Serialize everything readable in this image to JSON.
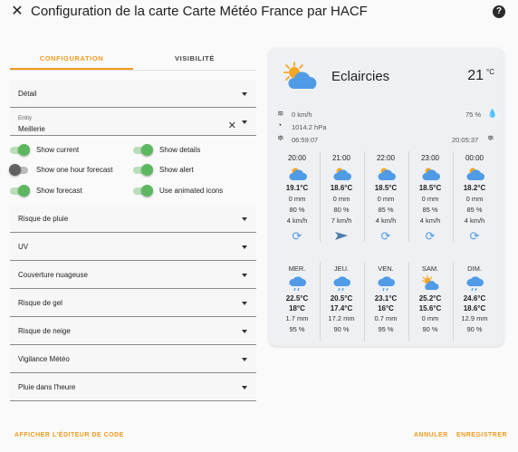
{
  "dialog": {
    "title": "Configuration de la carte Carte Météo France par HACF",
    "close_icon": "close-icon",
    "help_icon": "help-icon"
  },
  "tabs": [
    {
      "label": "CONFIGURATION",
      "active": true
    },
    {
      "label": "VISIBILITÉ",
      "active": false
    }
  ],
  "fields": {
    "detail": "Détail",
    "entity_label": "Entity",
    "entity_value": "Meillerie",
    "rain_risk": "Risque de pluie",
    "uv": "UV",
    "cloud_cover": "Couverture nuageuse",
    "frost_risk": "Risque de gel",
    "snow_risk": "Risque de neige",
    "vigilance": "Vigilance Météo",
    "rain_hour": "Pluie dans l'heure"
  },
  "toggles": [
    {
      "label": "Show current",
      "on": true
    },
    {
      "label": "Show details",
      "on": true
    },
    {
      "label": "Show one hour forecast",
      "on": false
    },
    {
      "label": "Show alert",
      "on": true
    },
    {
      "label": "Show forecast",
      "on": true
    },
    {
      "label": "Use animated icons",
      "on": true
    }
  ],
  "preview": {
    "condition": "Eclaircies",
    "temperature": "21",
    "temp_unit": "°C",
    "wind": "0 km/h",
    "pressure": "1014.2 hPa",
    "humidity": "75 %",
    "sunrise": "06:59:07",
    "sunset": "20:05:37",
    "hourly": [
      {
        "time": "20:00",
        "temp": "19.1°C",
        "rain": "0 mm",
        "pct": "80 %",
        "wind": "4 km/h",
        "wind_icon": "rotate-icon"
      },
      {
        "time": "21:00",
        "temp": "18.6°C",
        "rain": "0 mm",
        "pct": "80 %",
        "wind": "7 km/h",
        "wind_icon": "arrow-icon"
      },
      {
        "time": "22:00",
        "temp": "18.5°C",
        "rain": "0 mm",
        "pct": "85 %",
        "wind": "4 km/h",
        "wind_icon": "rotate-icon"
      },
      {
        "time": "23:00",
        "temp": "18.5°C",
        "rain": "0 mm",
        "pct": "85 %",
        "wind": "4 km/h",
        "wind_icon": "rotate-icon"
      },
      {
        "time": "00:00",
        "temp": "18.2°C",
        "rain": "0 mm",
        "pct": "85 %",
        "wind": "4 km/h",
        "wind_icon": "rotate-icon"
      }
    ],
    "daily": [
      {
        "day": "MER.",
        "max": "22.5°C",
        "min": "18°C",
        "rain": "1.7 mm",
        "pct": "95 %",
        "icon": "rain-cloud-icon"
      },
      {
        "day": "JEU.",
        "max": "20.5°C",
        "min": "17.4°C",
        "rain": "17.2 mm",
        "pct": "90 %",
        "icon": "rain-cloud-icon"
      },
      {
        "day": "VEN.",
        "max": "23.1°C",
        "min": "16°C",
        "rain": "0.7 mm",
        "pct": "95 %",
        "icon": "rain-cloud-icon"
      },
      {
        "day": "SAM.",
        "max": "25.2°C",
        "min": "15.6°C",
        "rain": "0 mm",
        "pct": "90 %",
        "icon": "sun-cloud-icon"
      },
      {
        "day": "DIM.",
        "max": "24.6°C",
        "min": "18.6°C",
        "rain": "12.9 mm",
        "pct": "90 %",
        "icon": "rain-cloud-icon"
      }
    ]
  },
  "footer": {
    "show_code": "AFFICHER L'ÉDITEUR DE CODE",
    "cancel": "ANNULER",
    "save": "ENREGISTRER"
  },
  "colors": {
    "accent": "#ef9a1f",
    "toggle_on": "#5cb85f",
    "cloud": "#4f9be6",
    "sun": "#f5a623"
  }
}
